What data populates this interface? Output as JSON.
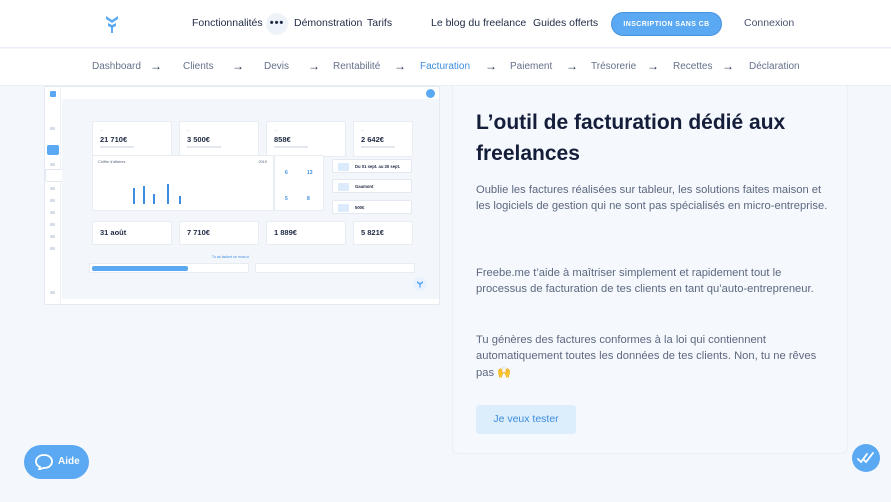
{
  "nav": {
    "items": [
      "Fonctionnalités",
      "Démonstration",
      "Tarifs",
      "Le blog du freelance",
      "Guides offerts"
    ],
    "more_label": "•••",
    "signup_label": "INSCRIPTION SANS CB",
    "login_label": "Connexion"
  },
  "steps": [
    "Dashboard",
    "Clients",
    "Devis",
    "Rentabilité",
    "Facturation",
    "Paiement",
    "Trésorerie",
    "Recettes",
    "Déclaration"
  ],
  "active_step": "Facturation",
  "preview": {
    "top_values": [
      "21 710€",
      "3 500€",
      "858€",
      "2 642€"
    ],
    "bottom_values": [
      "31 août",
      "7 710€",
      "1 889€",
      "5 821€"
    ],
    "chart_title": "Chiffre d'affaires",
    "chart_year": "2019",
    "kpis": [
      {
        "value": "6"
      },
      {
        "value": "13"
      },
      {
        "value": "5"
      },
      {
        "value": "8"
      }
    ],
    "feed": [
      "Du 01 sept. au 30 sept.",
      "Gaumont",
      "500€"
    ],
    "progress_label": "Tu as facturé ce mois-ci"
  },
  "content": {
    "headline": "L’outil de facturation dédié aux freelances",
    "paragraphs": [
      "Oublie les factures réalisées sur tableur, les solutions faites maison et les logiciels de gestion qui ne sont pas spécialisés en micro-entreprise.",
      "Freebe.me t’aide à maîtriser simplement et rapidement tout le processus de facturation de tes clients en tant qu’auto-entrepreneur.",
      "Tu génères des factures conformes à la loi qui contiennent automatiquement toutes les données de tes clients. Non, tu ne rêves pas 🙌"
    ],
    "cta_label": "Je veux tester"
  },
  "help": {
    "label": "Aide"
  },
  "colors": {
    "accent": "#5aa9f2",
    "active_step": "#3d8de0",
    "heading": "#141d3a"
  }
}
